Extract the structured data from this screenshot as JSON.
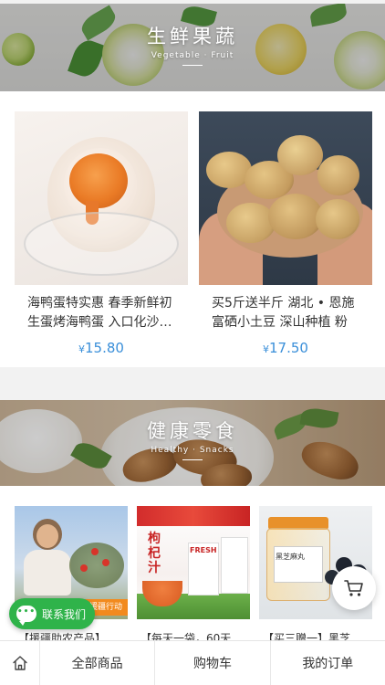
{
  "banners": [
    {
      "title": "生鲜果蔬",
      "subtitle": "Vegetable · Fruit"
    },
    {
      "title": "健康零食",
      "subtitle": "Healthy · Snacks"
    }
  ],
  "fresh_products": [
    {
      "name": "海鸭蛋特实惠 春季新鲜初生蛋烤海鸭蛋 入口化沙…",
      "currency": "¥",
      "price": "15.80"
    },
    {
      "name": "买5斤送半斤 湖北 • 恩施富硒小土豆 深山种植 粉嫩…",
      "currency": "¥",
      "price": "17.50"
    }
  ],
  "snack_products": [
    {
      "name": "【援疆助农产品】",
      "img_text": "助力援疆行动"
    },
    {
      "name": "【每天一袋，60天",
      "img_text_1": "枸杞汁",
      "img_text_2": "FRESH"
    },
    {
      "name": "【买三赠一】黑芝",
      "img_text": "黑芝麻丸"
    }
  ],
  "contact": {
    "label": "联系我们",
    "dots": "•••"
  },
  "tabbar": {
    "items": [
      "全部商品",
      "购物车",
      "我的订单"
    ]
  },
  "icons": {
    "home": "home-icon",
    "cart": "cart-icon",
    "chat": "chat-bubble-icon"
  },
  "colors": {
    "price": "#3a8fd9",
    "contact": "#2fb34a"
  }
}
